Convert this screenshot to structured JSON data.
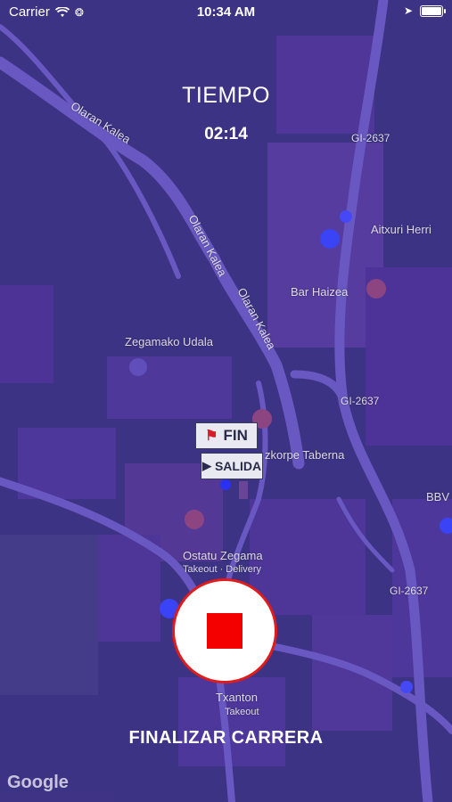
{
  "status_bar": {
    "carrier": "Carrier",
    "time": "10:34 AM"
  },
  "timer": {
    "title": "TIEMPO",
    "value": "02:14"
  },
  "map": {
    "streets": [
      "Olaran Kalea",
      "Olaran Kalea",
      "Olaran Kalea"
    ],
    "road_codes": [
      "GI-2637",
      "GI-2637",
      "GI-2637"
    ],
    "places": [
      "Aitxuri Herri",
      "Bar Haizea",
      "Zegamako Udala",
      "zkorpe Taberna",
      "Ostatu Zegama",
      "Takeout · Delivery",
      "Txanton",
      "Takeout",
      "BBV"
    ],
    "marker_fin": "FIN",
    "marker_salida": "SALIDA",
    "attribution": "Google"
  },
  "finish_button_label": "FINALIZAR CARRERA",
  "colors": {
    "overlay": "#3c14e6",
    "stop": "#f40000"
  }
}
